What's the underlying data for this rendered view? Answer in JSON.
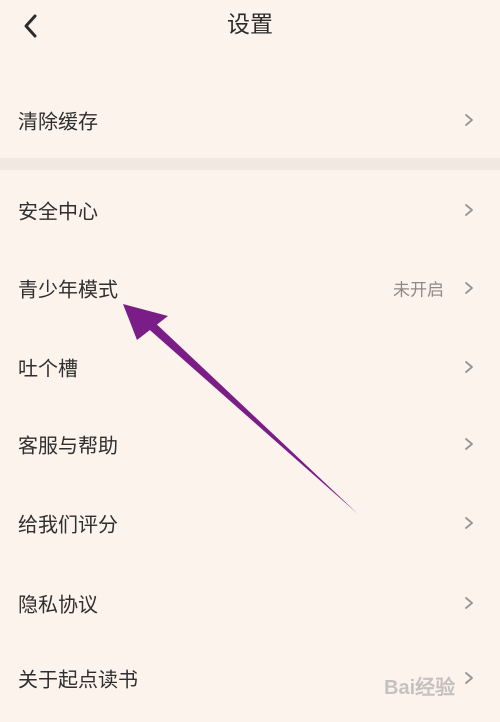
{
  "header": {
    "title": "设置"
  },
  "rows": [
    {
      "label": "清除缓存",
      "value": ""
    },
    {
      "label": "安全中心",
      "value": ""
    },
    {
      "label": "青少年模式",
      "value": "未开启"
    },
    {
      "label": "吐个槽",
      "value": ""
    },
    {
      "label": "客服与帮助",
      "value": ""
    },
    {
      "label": "给我们评分",
      "value": ""
    },
    {
      "label": "隐私协议",
      "value": ""
    },
    {
      "label": "关于起点读书",
      "value": ""
    }
  ],
  "watermark": {
    "text": "Bai经验"
  },
  "colors": {
    "background": "#fbf3ec",
    "annotation": "#7b1d86"
  },
  "icons": {
    "back": "chevron-left-icon",
    "row_arrow": "chevron-right-icon"
  }
}
